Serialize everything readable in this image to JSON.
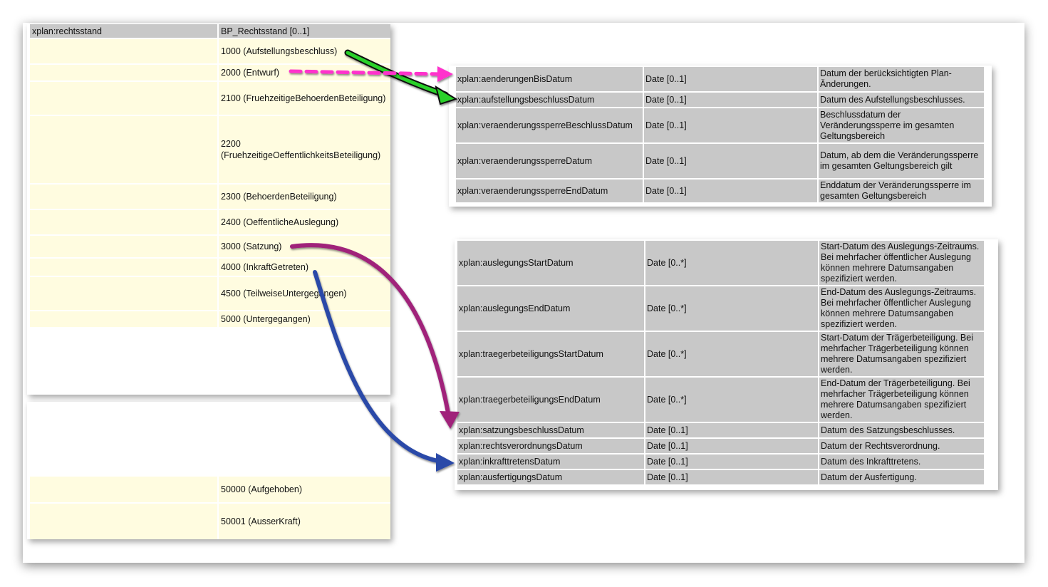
{
  "left_table": {
    "header": {
      "name": "xplan:rechtsstand",
      "type": "BP_Rechtsstand [0..1]"
    },
    "values": [
      "1000 (Aufstellungsbeschluss)",
      "2000 (Entwurf)",
      "2100 (FruehzeitigeBehoerdenBeteiligung)",
      "2200 (FruehzeitigeOeffentlichkeitsBeteiligung)",
      "2300 (BehoerdenBeteiligung)",
      "2400 (OeffentlicheAuslegung)",
      "3000 (Satzung)",
      "4000 (InkraftGetreten)",
      "4500 (TeilweiseUntergegangen)",
      "5000 (Untergegangen)"
    ],
    "values_lower": [
      "50000 (Aufgehoben)",
      "50001 (AusserKraft)"
    ]
  },
  "table_top": [
    {
      "name": "xplan:aenderungenBisDatum",
      "type": "Date [0..1]",
      "desc": "Datum der berücksichtigten Plan-Änderungen."
    },
    {
      "name": "xplan:aufstellungsbeschlussDatum",
      "type": "Date [0..1]",
      "desc": "Datum des Aufstellungsbeschlusses."
    },
    {
      "name": "xplan:veraenderungssperreBeschlussDatum",
      "type": "Date [0..1]",
      "desc": "Beschlussdatum der Veränderungssperre im gesamten Geltungsbereich"
    },
    {
      "name": "xplan:veraenderungssperreDatum",
      "type": "Date [0..1]",
      "desc": "Datum, ab dem die Veränderungssperre im gesamten Geltungsbereich gilt"
    },
    {
      "name": "xplan:veraenderungssperreEndDatum",
      "type": "Date [0..1]",
      "desc": "Enddatum der Veränderungssperre im gesamten Geltungsbereich"
    }
  ],
  "table_bottom": [
    {
      "name": "xplan:auslegungsStartDatum",
      "type": "Date [0..*]",
      "desc": "Start-Datum des Auslegungs-Zeitraums. Bei mehrfacher öffentlicher Auslegung können mehrere Datumsangaben spezifiziert werden."
    },
    {
      "name": "xplan:auslegungsEndDatum",
      "type": "Date [0..*]",
      "desc": "End-Datum des Auslegungs-Zeitraums. Bei mehrfacher öffentlicher Auslegung können mehrere Datumsangaben spezifiziert werden."
    },
    {
      "name": "xplan:traegerbeteiligungsStartDatum",
      "type": "Date [0..*]",
      "desc": "Start-Datum der Trägerbeteiligung. Bei mehrfacher Trägerbeteiligung können mehrere Datumsangaben spezifiziert werden."
    },
    {
      "name": "xplan:traegerbeteiligungsEndDatum",
      "type": "Date [0..*]",
      "desc": "End-Datum der Trägerbeteiligung. Bei mehrfacher Trägerbeteiligung können mehrere Datumsangaben spezifiziert werden."
    },
    {
      "name": "xplan:satzungsbeschlussDatum",
      "type": "Date [0..1]",
      "desc": "Datum des Satzungsbeschlusses."
    },
    {
      "name": "xplan:rechtsverordnungsDatum",
      "type": "Date [0..1]",
      "desc": "Datum der Rechtsverordnung."
    },
    {
      "name": "xplan:inkrafttretensDatum",
      "type": "Date [0..1]",
      "desc": "Datum des Inkrafttretens."
    },
    {
      "name": "xplan:ausfertigungsDatum",
      "type": "Date [0..1]",
      "desc": "Datum der Ausfertigung."
    }
  ],
  "arrows": [
    {
      "from": "1000 (Aufstellungsbeschluss)",
      "to": "xplan:aufstellungsbeschlussDatum",
      "color": "#22cc22",
      "style": "solid"
    },
    {
      "from": "2000 (Entwurf)",
      "to": "xplan:aenderungenBisDatum",
      "color": "#ff33cc",
      "style": "dashed"
    },
    {
      "from": "3000 (Satzung)",
      "to": "xplan:satzungsbeschlussDatum",
      "color": "#a0207a",
      "style": "solid"
    },
    {
      "from": "4000 (InkraftGetreten)",
      "to": "xplan:inkrafttretensDatum",
      "color": "#2a49a8",
      "style": "solid"
    }
  ]
}
